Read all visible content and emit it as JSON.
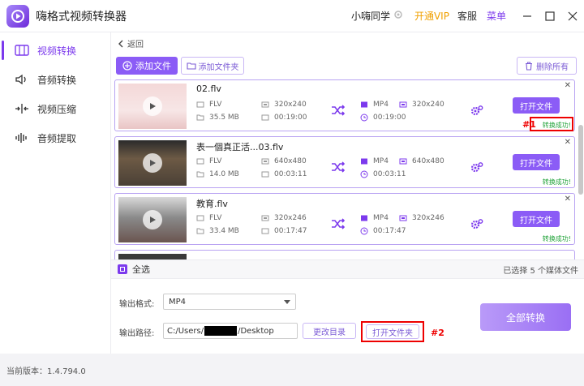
{
  "app": {
    "title": "嗨格式视频转换器",
    "brand_color": "#7c3aed"
  },
  "header": {
    "user_name": "小嗨同学",
    "vip_label": "开通VIP",
    "service_label": "客服",
    "menu_label": "菜单"
  },
  "sidebar": {
    "items": [
      {
        "label": "视频转换",
        "icon": "video-convert-icon",
        "active": true
      },
      {
        "label": "音频转换",
        "icon": "audio-convert-icon",
        "active": false
      },
      {
        "label": "视频压缩",
        "icon": "video-compress-icon",
        "active": false
      },
      {
        "label": "音频提取",
        "icon": "audio-extract-icon",
        "active": false
      }
    ]
  },
  "toolbar": {
    "back_label": "返回",
    "add_file_label": "添加文件",
    "add_folder_label": "添加文件夹",
    "delete_all_label": "删除所有"
  },
  "files": [
    {
      "name": "02.flv",
      "src_format": "FLV",
      "src_resolution": "320x240",
      "src_size": "35.5 MB",
      "src_duration": "00:19:00",
      "dst_format": "MP4",
      "dst_resolution": "320x240",
      "dst_duration": "00:19:00",
      "open_label": "打开文件",
      "status": "转换成功!",
      "annotation": "#1"
    },
    {
      "name": "表一個真正活...03.flv",
      "src_format": "FLV",
      "src_resolution": "640x480",
      "src_size": "14.0 MB",
      "src_duration": "00:03:11",
      "dst_format": "MP4",
      "dst_resolution": "640x480",
      "dst_duration": "00:03:11",
      "open_label": "打开文件",
      "status": "转换成功!"
    },
    {
      "name": "教育.flv",
      "src_format": "FLV",
      "src_resolution": "320x246",
      "src_size": "33.4 MB",
      "src_duration": "00:17:47",
      "dst_format": "MP4",
      "dst_resolution": "320x246",
      "dst_duration": "00:17:47",
      "open_label": "打开文件",
      "status": "转换成功!"
    }
  ],
  "selection": {
    "select_all_label": "全选",
    "selected_text": "已选择 5 个媒体文件"
  },
  "output": {
    "format_label": "输出格式:",
    "format_value": "MP4",
    "path_label": "输出路径:",
    "path_prefix": "C:/Users/",
    "path_suffix": "/Desktop",
    "change_dir_label": "更改目录",
    "open_folder_label": "打开文件夹",
    "annotation": "#2",
    "convert_all_label": "全部转换"
  },
  "status": {
    "version_text": "当前版本：1.4.794.0"
  }
}
